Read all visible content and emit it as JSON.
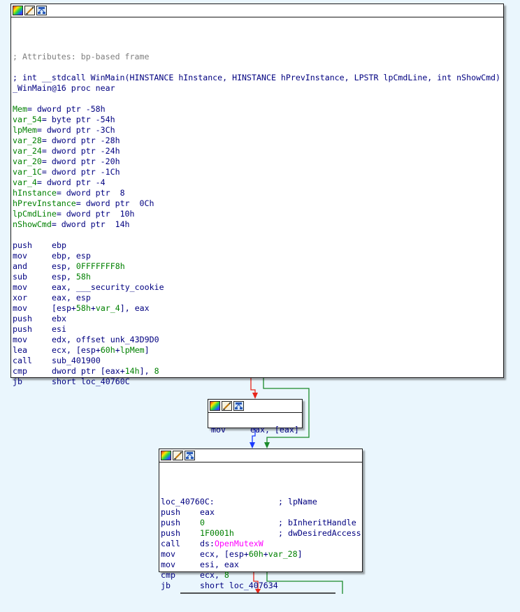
{
  "node1": {
    "comment_attr": "; Attributes: bp-based frame",
    "signature": "; int __stdcall WinMain(HINSTANCE hInstance, HINSTANCE hPrevInstance, LPSTR lpCmdLine, int nShowCmd)",
    "proc": "_WinMain@16 proc near",
    "vars": [
      {
        "name": "Mem",
        "rest": "= dword ptr -58h"
      },
      {
        "name": "var_54",
        "rest": "= byte ptr -54h"
      },
      {
        "name": "lpMem",
        "rest": "= dword ptr -3Ch"
      },
      {
        "name": "var_28",
        "rest": "= dword ptr -28h"
      },
      {
        "name": "var_24",
        "rest": "= dword ptr -24h"
      },
      {
        "name": "var_20",
        "rest": "= dword ptr -20h"
      },
      {
        "name": "var_1C",
        "rest": "= dword ptr -1Ch"
      },
      {
        "name": "var_4",
        "rest": "= dword ptr -4"
      },
      {
        "name": "hInstance",
        "rest": "= dword ptr  8"
      },
      {
        "name": "hPrevInstance",
        "rest": "= dword ptr  0Ch"
      },
      {
        "name": "lpCmdLine",
        "rest": "= dword ptr  10h"
      },
      {
        "name": "nShowCmd",
        "rest": "= dword ptr  14h"
      }
    ],
    "code": [
      {
        "op": "push",
        "p": [
          [
            "ebp",
            "n"
          ]
        ]
      },
      {
        "op": "mov",
        "p": [
          [
            "ebp, esp",
            "n"
          ]
        ]
      },
      {
        "op": "and",
        "p": [
          [
            "esp, ",
            "n"
          ],
          [
            "0FFFFFFF8h",
            "g"
          ]
        ]
      },
      {
        "op": "sub",
        "p": [
          [
            "esp, ",
            "n"
          ],
          [
            "58h",
            "g"
          ]
        ]
      },
      {
        "op": "mov",
        "p": [
          [
            "eax, ",
            "n"
          ],
          [
            "___security_cookie",
            "n"
          ]
        ]
      },
      {
        "op": "xor",
        "p": [
          [
            "eax, esp",
            "n"
          ]
        ]
      },
      {
        "op": "mov",
        "p": [
          [
            "[esp+",
            "n"
          ],
          [
            "58h",
            "g"
          ],
          [
            "+",
            "n"
          ],
          [
            "var_4",
            "g"
          ],
          [
            "], eax",
            "n"
          ]
        ]
      },
      {
        "op": "push",
        "p": [
          [
            "ebx",
            "n"
          ]
        ]
      },
      {
        "op": "push",
        "p": [
          [
            "esi",
            "n"
          ]
        ]
      },
      {
        "op": "mov",
        "p": [
          [
            "edx, offset unk_43D9D0",
            "n"
          ]
        ]
      },
      {
        "op": "lea",
        "p": [
          [
            "ecx, [esp+",
            "n"
          ],
          [
            "60h",
            "g"
          ],
          [
            "+",
            "n"
          ],
          [
            "lpMem",
            "g"
          ],
          [
            "]",
            "n"
          ]
        ]
      },
      {
        "op": "call",
        "p": [
          [
            "sub_401900",
            "n"
          ]
        ]
      },
      {
        "op": "cmp",
        "p": [
          [
            "dword ptr [eax+",
            "n"
          ],
          [
            "14h",
            "g"
          ],
          [
            "], ",
            "n"
          ],
          [
            "8",
            "g"
          ]
        ]
      },
      {
        "op": "jb",
        "p": [
          [
            "short loc_40760C",
            "n"
          ]
        ]
      }
    ]
  },
  "node2": {
    "op": "mov",
    "arg": "eax, [eax]"
  },
  "node3": {
    "label": "loc_40760C:",
    "label_comment": "; lpName",
    "code": [
      {
        "op": "push",
        "p": [
          [
            "eax",
            "n"
          ]
        ],
        "c": ""
      },
      {
        "op": "push",
        "p": [
          [
            "0",
            "g"
          ]
        ],
        "c": "; bInheritHandle"
      },
      {
        "op": "push",
        "p": [
          [
            "1F0001h",
            "g"
          ]
        ],
        "c": "; dwDesiredAccess"
      },
      {
        "op": "call",
        "p": [
          [
            "ds:",
            "n"
          ],
          [
            "OpenMutexW",
            "m"
          ]
        ],
        "c": ""
      },
      {
        "op": "mov",
        "p": [
          [
            "ecx, [esp+",
            "n"
          ],
          [
            "60h",
            "g"
          ],
          [
            "+",
            "n"
          ],
          [
            "var_28",
            "g"
          ],
          [
            "]",
            "n"
          ]
        ],
        "c": ""
      },
      {
        "op": "mov",
        "p": [
          [
            "esi, eax",
            "n"
          ]
        ],
        "c": ""
      },
      {
        "op": "cmp",
        "p": [
          [
            "ecx, ",
            "n"
          ],
          [
            "8",
            "g"
          ]
        ],
        "c": ""
      },
      {
        "op": "jb",
        "p": [
          [
            "short loc_407634",
            "n"
          ]
        ],
        "c": ""
      }
    ]
  },
  "colors": {
    "background": "#eaf6fd",
    "edge_true": "#e8261a",
    "edge_false": "#1a8a2a",
    "edge_uncond": "#1a3aff"
  }
}
